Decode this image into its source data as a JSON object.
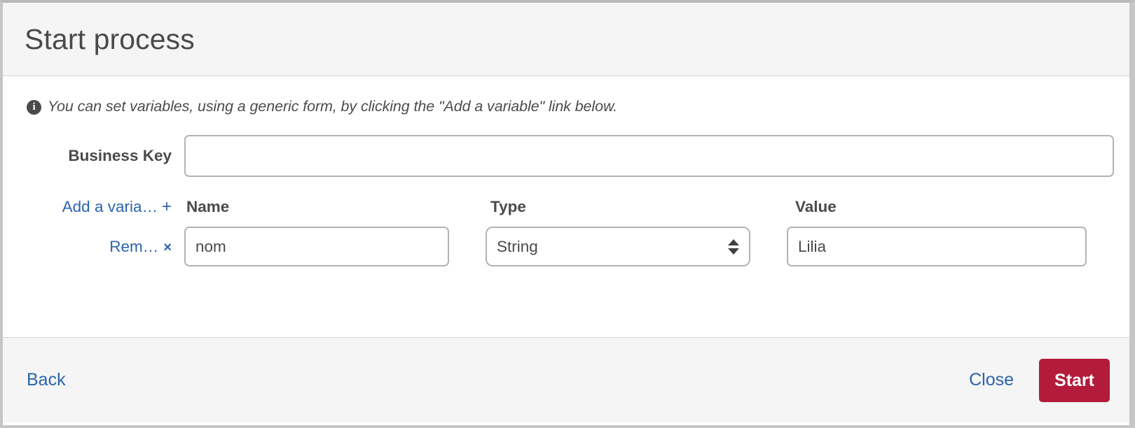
{
  "modal": {
    "title": "Start process"
  },
  "info": {
    "icon": "info-circle-icon",
    "text": "You can set variables, using a generic form, by clicking the \"Add a variable\" link below."
  },
  "form": {
    "business_key": {
      "label": "Business Key",
      "value": "",
      "placeholder": ""
    },
    "add_variable_link": {
      "label": "Add a varia…",
      "plus": "+"
    },
    "headers": {
      "name": "Name",
      "type": "Type",
      "value": "Value"
    },
    "variables": [
      {
        "remove_label": "Rem…",
        "remove_icon": "×",
        "name": "nom",
        "type": "String",
        "type_options": [
          "String"
        ],
        "value": "Lilia"
      }
    ]
  },
  "footer": {
    "back_label": "Back",
    "close_label": "Close",
    "start_label": "Start"
  },
  "colors": {
    "link": "#2a64ad",
    "start_button": "#b31b3b",
    "header_bg": "#f5f5f5",
    "text": "#4a4a4a",
    "input_border": "#b3b3b3"
  }
}
